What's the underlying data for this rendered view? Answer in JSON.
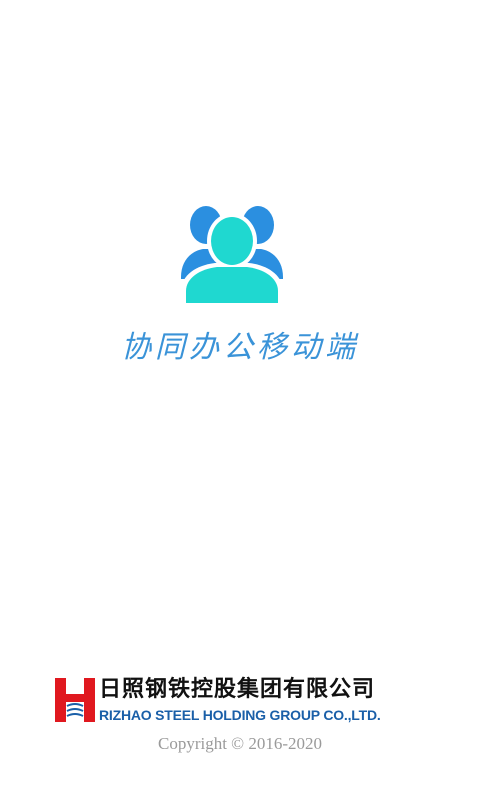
{
  "splash": {
    "app_icon": "users-group-icon",
    "app_title": "协同办公移动端",
    "company": {
      "logo_icon": "rizhao-steel-logo-icon",
      "name_cn": "日照钢铁控股集团有限公司",
      "name_en": "RIZHAO STEEL HOLDING GROUP CO.,LTD."
    },
    "copyright": "Copyright © 2016-2020"
  },
  "colors": {
    "background": "#ffffff",
    "icon_back": "#2b8fe0",
    "icon_front": "#1fd8d0",
    "title": "#3a93d8",
    "logo_red": "#e0181f",
    "company_en": "#1a5fa8",
    "copyright": "#9a9a9a"
  }
}
